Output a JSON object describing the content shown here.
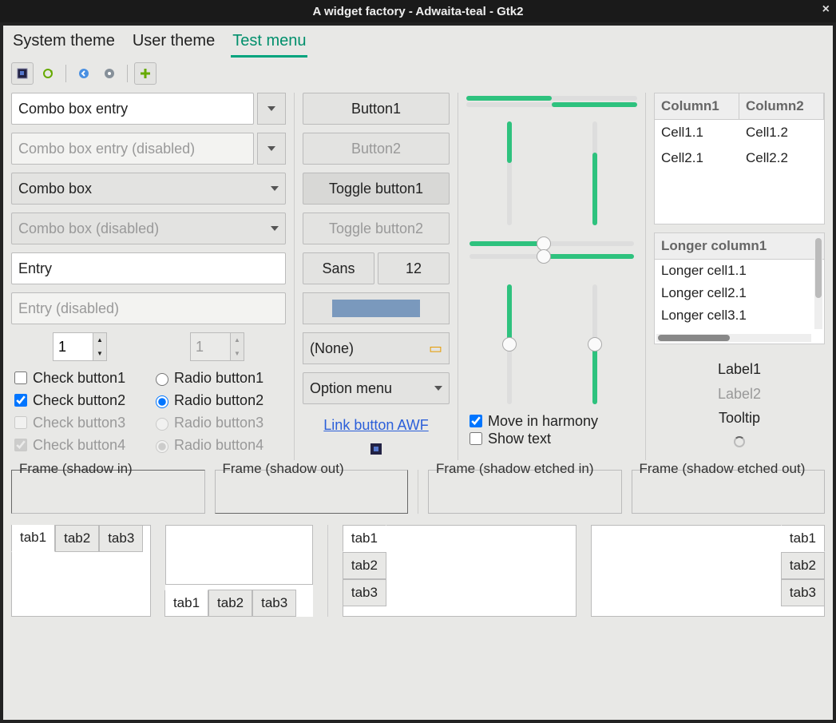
{
  "window": {
    "title": "A widget factory - Adwaita-teal - Gtk2"
  },
  "menubar": {
    "items": [
      {
        "label": "System theme"
      },
      {
        "label": "User theme"
      },
      {
        "label": "Test menu",
        "active": true
      }
    ]
  },
  "toolbar": {
    "icons": [
      "square-icon",
      "refresh-icon",
      "back-icon",
      "disc-icon",
      "plus-icon"
    ]
  },
  "col1": {
    "combo_entry": "Combo box entry",
    "combo_entry_disabled": "Combo box entry (disabled)",
    "combo_box": "Combo box",
    "combo_box_disabled": "Combo box (disabled)",
    "entry": "Entry",
    "entry_disabled": "Entry (disabled)",
    "spin1": "1",
    "spin2": "1",
    "checks": [
      "Check button1",
      "Radio button1",
      "Check button2",
      "Radio button2",
      "Check button3",
      "Radio button3",
      "Check button4",
      "Radio button4"
    ]
  },
  "col2": {
    "button1": "Button1",
    "button2": "Button2",
    "toggle1": "Toggle button1",
    "toggle2": "Toggle button2",
    "font_name": "Sans",
    "font_size": "12",
    "color": "#7a99bd",
    "file_none": "(None)",
    "option_menu": "Option menu",
    "link": "Link button AWF"
  },
  "col3": {
    "move_harmony": "Move in harmony",
    "show_text": "Show text"
  },
  "col4": {
    "table1": {
      "headers": [
        "Column1",
        "Column2"
      ],
      "rows": [
        [
          "Cell1.1",
          "Cell1.2"
        ],
        [
          "Cell2.1",
          "Cell2.2"
        ]
      ]
    },
    "table2": {
      "header": "Longer column1",
      "rows": [
        "Longer cell1.1",
        "Longer cell2.1",
        "Longer cell3.1"
      ]
    },
    "label1": "Label1",
    "label2": "Label2",
    "tooltip": "Tooltip"
  },
  "frames": {
    "f1": "Frame (shadow in)",
    "f2": "Frame (shadow out)",
    "f3": "Frame (shadow etched in)",
    "f4": "Frame (shadow etched out)"
  },
  "tabs": {
    "t1": "tab1",
    "t2": "tab2",
    "t3": "tab3"
  }
}
